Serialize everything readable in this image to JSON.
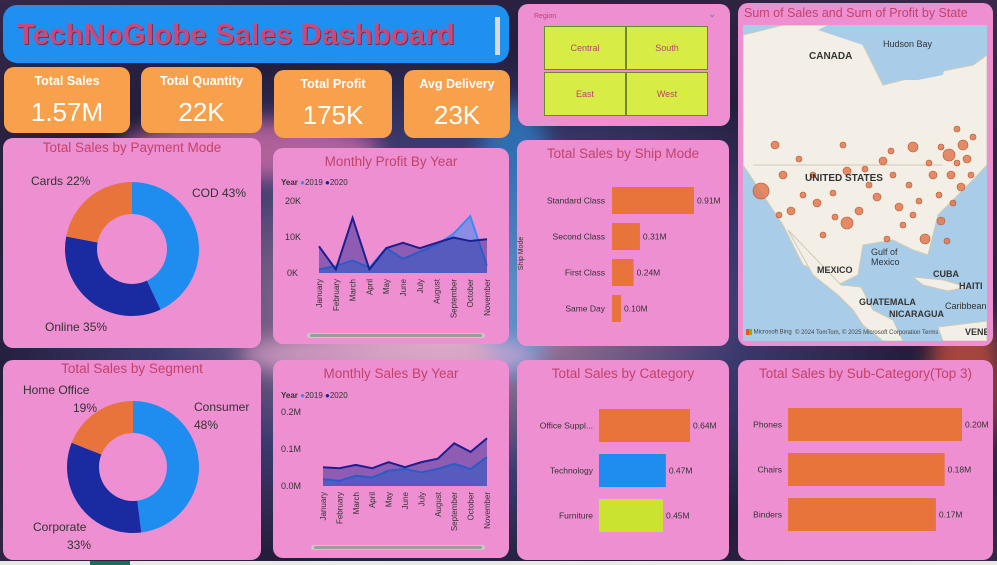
{
  "dashboard": {
    "title": "TechNoGlobe Sales Dashboard"
  },
  "kpis": {
    "total_sales": {
      "label": "Total Sales",
      "value": "1.57M"
    },
    "total_quantity": {
      "label": "Total Quantity",
      "value": "22K"
    },
    "total_profit": {
      "label": "Total Profit",
      "value": "175K"
    },
    "avg_delivery": {
      "label": "Avg Delivery",
      "value": "23K"
    }
  },
  "region_slicer": {
    "label": "Region",
    "options": [
      "Central",
      "South",
      "East",
      "West"
    ]
  },
  "payment_mode": {
    "title": "Total Sales by Payment Mode",
    "labels": {
      "cod": "COD 43%",
      "cards": "Cards 22%",
      "online": "Online 35%"
    }
  },
  "segment": {
    "title": "Total Sales by Segment",
    "labels": {
      "consumer_name": "Consumer",
      "consumer_pct": "48%",
      "home_name": "Home Office",
      "home_pct": "19%",
      "corporate_name": "Corporate",
      "corporate_pct": "33%"
    }
  },
  "monthly_profit": {
    "title": "Monthly Profit By Year",
    "legend_title": "Year",
    "series_2019": "2019",
    "series_2020": "2020",
    "yticks": [
      "20K",
      "10K",
      "0K"
    ]
  },
  "monthly_sales": {
    "title": "Monthly Sales By Year",
    "legend_title": "Year",
    "series_2019": "2019",
    "series_2020": "2020",
    "yticks": [
      "0.2M",
      "0.1M",
      "0.0M"
    ]
  },
  "months": [
    "January",
    "February",
    "March",
    "April",
    "May",
    "June",
    "July",
    "August",
    "September",
    "October",
    "November"
  ],
  "ship_mode": {
    "title": "Total Sales by Ship Mode",
    "axis_label": "Ship Mode",
    "rows": [
      {
        "label": "Standard Class",
        "value_label": "0.91M"
      },
      {
        "label": "Second Class",
        "value_label": "0.31M"
      },
      {
        "label": "First Class",
        "value_label": "0.24M"
      },
      {
        "label": "Same Day",
        "value_label": "0.10M"
      }
    ]
  },
  "category": {
    "title": "Total Sales by Category",
    "rows": [
      {
        "label": "Office Suppl...",
        "value_label": "0.64M"
      },
      {
        "label": "Technology",
        "value_label": "0.47M"
      },
      {
        "label": "Furniture",
        "value_label": "0.45M"
      }
    ]
  },
  "subcategory": {
    "title": "Total Sales by Sub-Category(Top 3)",
    "rows": [
      {
        "label": "Phones",
        "value_label": "0.20M"
      },
      {
        "label": "Chairs",
        "value_label": "0.18M"
      },
      {
        "label": "Binders",
        "value_label": "0.17M"
      }
    ]
  },
  "map": {
    "title": "Sum of Sales and Sum of Profit by State",
    "labels": {
      "canada": "CANADA",
      "hudson": "Hudson Bay",
      "us": "UNITED STATES",
      "mexico": "MEXICO",
      "gulf": "Gulf of Mexico",
      "cuba": "CUBA",
      "haiti": "HAITI",
      "caribbean": "Caribbean",
      "guatemala": "GUATEMALA",
      "nicaragua": "NICARAGUA",
      "venezuela": "VENEZ"
    },
    "attribution": "Microsoft Bing",
    "copyright": "© 2024 TomTom, © 2025 Microsoft Corporation  Terms"
  },
  "chart_data": [
    {
      "type": "pie",
      "title": "Total Sales by Payment Mode",
      "categories": [
        "COD",
        "Online",
        "Cards"
      ],
      "values": [
        43,
        35,
        22
      ],
      "colors": [
        "#1f8cf0",
        "#1a2aa0",
        "#e8743b"
      ]
    },
    {
      "type": "pie",
      "title": "Total Sales by Segment",
      "categories": [
        "Consumer",
        "Corporate",
        "Home Office"
      ],
      "values": [
        48,
        33,
        19
      ],
      "colors": [
        "#1f8cf0",
        "#1a2aa0",
        "#e8743b"
      ]
    },
    {
      "type": "area",
      "title": "Monthly Profit By Year",
      "categories": [
        "January",
        "February",
        "March",
        "April",
        "May",
        "June",
        "July",
        "August",
        "September",
        "October",
        "November"
      ],
      "ylim": [
        0,
        20000
      ],
      "series": [
        {
          "name": "2019",
          "color": "#3b8cf2",
          "values": [
            1000,
            2000,
            3500,
            1500,
            7000,
            4000,
            6000,
            8000,
            11000,
            16000,
            2000
          ]
        },
        {
          "name": "2020",
          "color": "#1a2090",
          "values": [
            7500,
            1000,
            15500,
            1000,
            7000,
            8500,
            7000,
            8500,
            10000,
            9000,
            9500
          ]
        }
      ]
    },
    {
      "type": "area",
      "title": "Monthly Sales By Year",
      "categories": [
        "January",
        "February",
        "March",
        "April",
        "May",
        "June",
        "July",
        "August",
        "September",
        "October",
        "November"
      ],
      "ylim": [
        0,
        0.22
      ],
      "series": [
        {
          "name": "2019",
          "color": "#3b8cf2",
          "values": [
            0.02,
            0.015,
            0.03,
            0.025,
            0.045,
            0.05,
            0.04,
            0.05,
            0.065,
            0.05,
            0.085
          ]
        },
        {
          "name": "2020",
          "color": "#1a2090",
          "values": [
            0.055,
            0.052,
            0.062,
            0.052,
            0.07,
            0.055,
            0.07,
            0.08,
            0.125,
            0.1,
            0.14
          ]
        }
      ]
    },
    {
      "type": "bar",
      "title": "Total Sales by Ship Mode",
      "categories": [
        "Standard Class",
        "Second Class",
        "First Class",
        "Same Day"
      ],
      "values": [
        0.91,
        0.31,
        0.24,
        0.1
      ],
      "color": "#e8743b"
    },
    {
      "type": "bar",
      "title": "Total Sales by Category",
      "categories": [
        "Office Supplies",
        "Technology",
        "Furniture"
      ],
      "values": [
        0.64,
        0.47,
        0.45
      ],
      "colors": [
        "#e8743b",
        "#1f8cf0",
        "#c9e330"
      ]
    },
    {
      "type": "bar",
      "title": "Total Sales by Sub-Category(Top 3)",
      "categories": [
        "Phones",
        "Chairs",
        "Binders"
      ],
      "values": [
        0.2,
        0.18,
        0.17
      ],
      "color": "#e8743b"
    }
  ]
}
